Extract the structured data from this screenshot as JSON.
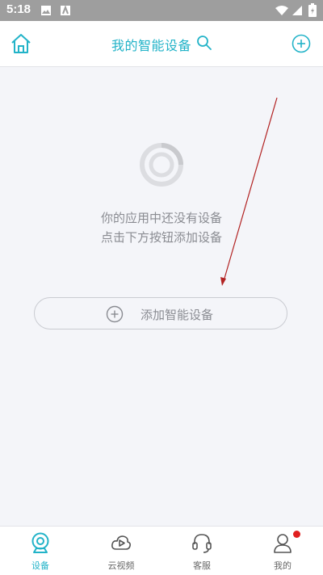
{
  "status_bar": {
    "time": "5:18"
  },
  "header": {
    "title": "我的智能设备"
  },
  "empty_state": {
    "line1": "你的应用中还没有设备",
    "line2": "点击下方按钮添加设备",
    "add_button_label": "添加智能设备"
  },
  "bottom_nav": {
    "tabs": [
      {
        "label": "设备",
        "icon": "device-camera-icon",
        "active": true
      },
      {
        "label": "云视频",
        "icon": "cloud-video-icon",
        "active": false
      },
      {
        "label": "客服",
        "icon": "headset-icon",
        "active": false
      },
      {
        "label": "我的",
        "icon": "person-icon",
        "active": false
      }
    ]
  },
  "colors": {
    "accent": "#22b3c8",
    "background": "#f4f5f9",
    "text_muted": "#8a8c92",
    "badge": "#e02020",
    "arrow": "#b22222"
  }
}
